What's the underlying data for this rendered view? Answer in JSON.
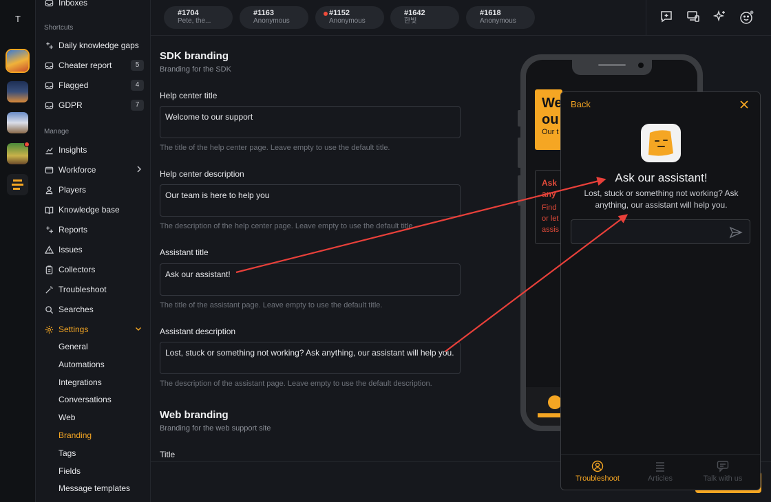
{
  "rail": {
    "workspace_letter": "T"
  },
  "sidebar": {
    "partial_top_item": "Inboxes",
    "shortcuts_label": "Shortcuts",
    "shortcuts": [
      {
        "label": "Daily knowledge gaps",
        "icon": "sparkle-icon"
      },
      {
        "label": "Cheater report",
        "icon": "inbox-icon",
        "count": "5"
      },
      {
        "label": "Flagged",
        "icon": "inbox-icon",
        "count": "4"
      },
      {
        "label": "GDPR",
        "icon": "inbox-icon",
        "count": "7"
      }
    ],
    "manage_label": "Manage",
    "manage": [
      {
        "label": "Insights",
        "icon": "chart-icon"
      },
      {
        "label": "Workforce",
        "icon": "window-icon"
      },
      {
        "label": "Players",
        "icon": "person-icon"
      },
      {
        "label": "Knowledge base",
        "icon": "book-icon"
      },
      {
        "label": "Reports",
        "icon": "sparkle-icon"
      },
      {
        "label": "Issues",
        "icon": "warning-icon"
      },
      {
        "label": "Collectors",
        "icon": "clipboard-icon"
      },
      {
        "label": "Troubleshoot",
        "icon": "wand-icon"
      },
      {
        "label": "Searches",
        "icon": "search-icon"
      },
      {
        "label": "Settings",
        "icon": "gear-icon"
      }
    ],
    "settings_items": [
      "General",
      "Automations",
      "Integrations",
      "Conversations",
      "Web",
      "Branding",
      "Tags",
      "Fields",
      "Message templates"
    ],
    "active_setting": "Branding"
  },
  "tabs": [
    {
      "id": "#1704",
      "sub": "Pete, the..."
    },
    {
      "id": "#1163",
      "sub": "Anonymous"
    },
    {
      "id": "#1152",
      "sub": "Anonymous",
      "unread": true
    },
    {
      "id": "#1642",
      "sub": "한빛"
    },
    {
      "id": "#1618",
      "sub": "Anonymous"
    }
  ],
  "form": {
    "sdk_title": "SDK branding",
    "sdk_subtitle": "Branding for the SDK",
    "fields": [
      {
        "label": "Help center title",
        "value": "Welcome to our support",
        "help": "The title of the help center page. Leave empty to use the default title."
      },
      {
        "label": "Help center description",
        "value": "Our team is here to help you",
        "help": "The description of the help center page. Leave empty to use the default title."
      },
      {
        "label": "Assistant title",
        "value": "Ask our assistant!",
        "help": "The title of the assistant page. Leave empty to use the default title."
      },
      {
        "label": "Assistant description",
        "value": "Lost, stuck or something not working? Ask anything, our assistant will help you.",
        "help": "The description of the assistant page. Leave empty to use the default description."
      }
    ],
    "web_title": "Web branding",
    "web_subtitle": "Branding for the web support site",
    "web_field_label": "Title"
  },
  "phone": {
    "card1_big": "We\nou",
    "card1_small": "Our t",
    "card2_lines": [
      "Ask",
      "any",
      "Find",
      "or let",
      "assis"
    ]
  },
  "widget": {
    "back_label": "Back",
    "title": "Ask our assistant!",
    "description": "Lost, stuck or something not working? Ask anything, our assistant will help you.",
    "input_placeholder": "",
    "nav": [
      {
        "label": "Troubleshoot",
        "icon": "troubleshoot-icon",
        "active": true
      },
      {
        "label": "Articles",
        "icon": "articles-icon",
        "active": false
      },
      {
        "label": "Talk with us",
        "icon": "chat-icon",
        "active": false
      }
    ]
  },
  "colors": {
    "accent": "#f5a623",
    "annotation": "#e8403a",
    "background": "#16181d"
  }
}
